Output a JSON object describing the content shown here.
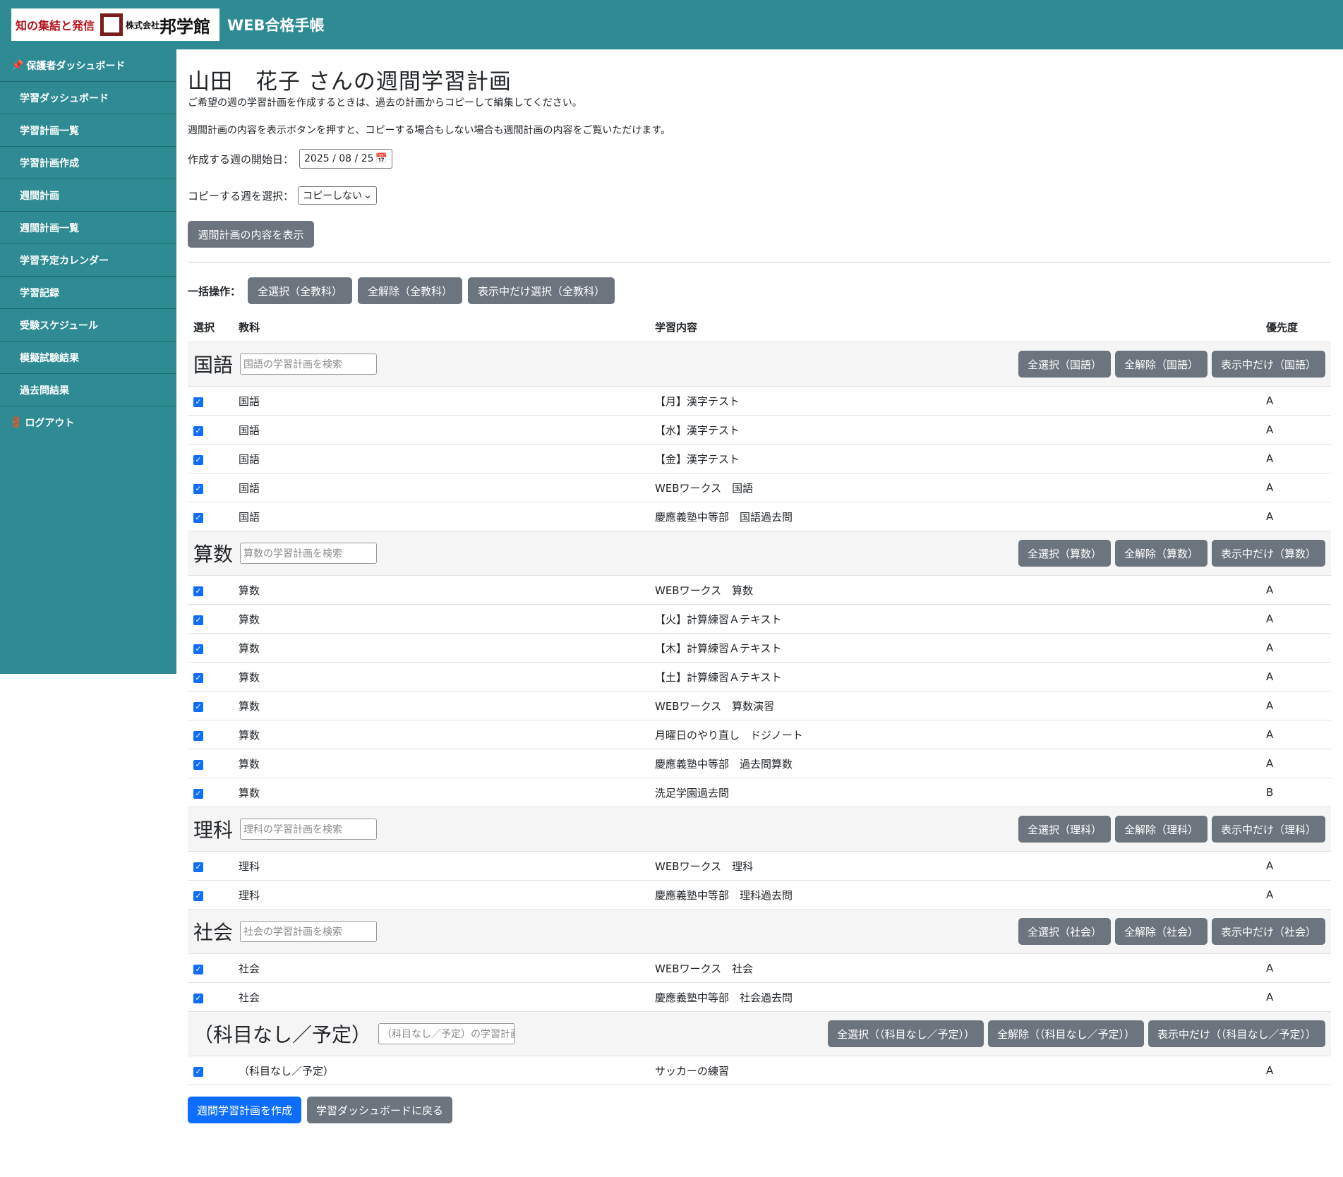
{
  "header": {
    "logo_slogan": "知の集結と発信",
    "logo_corp": "株式会社",
    "logo_name": "邦学館",
    "app_title": "WEB合格手帳"
  },
  "sidebar": {
    "items": [
      {
        "label": "保護者ダッシュボード",
        "icon": "pin-icon"
      },
      {
        "label": "学習ダッシュボード"
      },
      {
        "label": "学習計画一覧"
      },
      {
        "label": "学習計画作成"
      },
      {
        "label": "週間計画"
      },
      {
        "label": "週間計画一覧"
      },
      {
        "label": "学習予定カレンダー"
      },
      {
        "label": "学習記録"
      },
      {
        "label": "受験スケジュール"
      },
      {
        "label": "模擬試験結果"
      },
      {
        "label": "過去問結果"
      },
      {
        "label": "ログアウト",
        "icon": "door-icon"
      }
    ]
  },
  "page": {
    "title": "山田　花子 さんの週間学習計画",
    "desc1": "ご希望の週の学習計画を作成するときは、過去の計画からコピーして編集してください。",
    "desc2": "週間計画の内容を表示ボタンを押すと、コピーする場合もしない場合も週間計画の内容をご覧いただけます。",
    "start_label": "作成する週の開始日：",
    "start_value": "2025 / 08 / 25",
    "copy_label": "コピーする週を選択：",
    "copy_value": "コピーしない",
    "show_button": "週間計画の内容を表示",
    "bulk_label": "一括操作：",
    "bulk_select_all": "全選択（全教科）",
    "bulk_clear_all": "全解除（全教科）",
    "bulk_select_shown": "表示中だけ選択（全教科）"
  },
  "table": {
    "headers": {
      "select": "選択",
      "subject": "教科",
      "content": "学習内容",
      "priority": "優先度"
    },
    "groups": [
      {
        "name": "国語",
        "search_placeholder": "国語の学習計画を検索",
        "btn_select": "全選択（国語）",
        "btn_clear": "全解除（国語）",
        "btn_shown": "表示中だけ（国語）",
        "rows": [
          {
            "subject": "国語",
            "content": "【月】漢字テスト",
            "priority": "A"
          },
          {
            "subject": "国語",
            "content": "【水】漢字テスト",
            "priority": "A"
          },
          {
            "subject": "国語",
            "content": "【金】漢字テスト",
            "priority": "A"
          },
          {
            "subject": "国語",
            "content": "WEBワークス　国語",
            "priority": "A"
          },
          {
            "subject": "国語",
            "content": "慶應義塾中等部　国語過去問",
            "priority": "A"
          }
        ]
      },
      {
        "name": "算数",
        "search_placeholder": "算数の学習計画を検索",
        "btn_select": "全選択（算数）",
        "btn_clear": "全解除（算数）",
        "btn_shown": "表示中だけ（算数）",
        "rows": [
          {
            "subject": "算数",
            "content": "WEBワークス　算数",
            "priority": "A"
          },
          {
            "subject": "算数",
            "content": "【火】計算練習Ａテキスト",
            "priority": "A"
          },
          {
            "subject": "算数",
            "content": "【木】計算練習Ａテキスト",
            "priority": "A"
          },
          {
            "subject": "算数",
            "content": "【土】計算練習Ａテキスト",
            "priority": "A"
          },
          {
            "subject": "算数",
            "content": "WEBワークス　算数演習",
            "priority": "A"
          },
          {
            "subject": "算数",
            "content": "月曜日のやり直し　ドジノート",
            "priority": "A"
          },
          {
            "subject": "算数",
            "content": "慶應義塾中等部　過去問算数",
            "priority": "A"
          },
          {
            "subject": "算数",
            "content": "洗足学園過去問",
            "priority": "B"
          }
        ]
      },
      {
        "name": "理科",
        "search_placeholder": "理科の学習計画を検索",
        "btn_select": "全選択（理科）",
        "btn_clear": "全解除（理科）",
        "btn_shown": "表示中だけ（理科）",
        "rows": [
          {
            "subject": "理科",
            "content": "WEBワークス　理科",
            "priority": "A"
          },
          {
            "subject": "理科",
            "content": "慶應義塾中等部　理科過去問",
            "priority": "A"
          }
        ]
      },
      {
        "name": "社会",
        "search_placeholder": "社会の学習計画を検索",
        "btn_select": "全選択（社会）",
        "btn_clear": "全解除（社会）",
        "btn_shown": "表示中だけ（社会）",
        "rows": [
          {
            "subject": "社会",
            "content": "WEBワークス　社会",
            "priority": "A"
          },
          {
            "subject": "社会",
            "content": "慶應義塾中等部　社会過去問",
            "priority": "A"
          }
        ]
      },
      {
        "name": "（科目なし／予定）",
        "search_placeholder": "（科目なし／予定）の学習計画を検索",
        "btn_select": "全選択（（科目なし／予定））",
        "btn_clear": "全解除（（科目なし／予定））",
        "btn_shown": "表示中だけ（（科目なし／予定））",
        "rows": [
          {
            "subject": "（科目なし／予定）",
            "content": "サッカーの練習",
            "priority": "A"
          }
        ]
      }
    ]
  },
  "footer": {
    "create_button": "週間学習計画を作成",
    "back_button": "学習ダッシュボードに戻る"
  },
  "colors": {
    "brand_teal": "#2e8b94",
    "button_gray": "#6c757d",
    "primary_blue": "#0d6efd"
  }
}
